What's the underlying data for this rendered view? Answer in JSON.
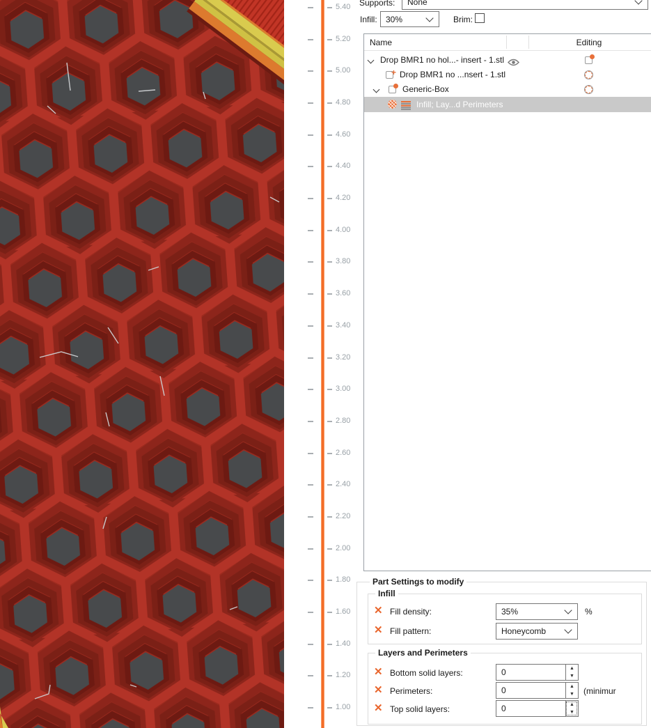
{
  "theme": {
    "accent_orange": "#f26a24",
    "icon_orange": "#e8703a",
    "wall_red": "#9c2a1e",
    "wall_red_light": "#b23327",
    "wall_red_mid": "#8d251b",
    "wall_red_dark": "#7b2016",
    "wall_red_deep": "#6d1a12",
    "hole_gray": "#484a4c",
    "band_yellow": "#d9cb4e",
    "band_yellow2": "#cfc144",
    "band_olive": "#a89a35",
    "band_orange": "#dd7a2e",
    "band_red": "#c23526",
    "band_rib": "#a32417",
    "band_shadow": "#6b1b12",
    "travel_gray": "#cdd0d2",
    "selected_row_bg": "#c9c9c9",
    "slider_label_gray": "#99a1a7"
  },
  "toolbar": {
    "supports_label": "Supports:",
    "supports_value": "None",
    "infill_label": "Infill:",
    "infill_value": "30%",
    "brim_label": "Brim:",
    "brim_checked": false
  },
  "layer_slider": {
    "tick_labels": [
      "5.40",
      "5.20",
      "5.00",
      "4.80",
      "4.60",
      "4.40",
      "4.20",
      "4.00",
      "3.80",
      "3.60",
      "3.40",
      "3.20",
      "3.00",
      "2.80",
      "2.60",
      "2.40",
      "2.20",
      "2.00",
      "1.80",
      "1.60",
      "1.40",
      "1.20",
      "1.00"
    ]
  },
  "object_tree": {
    "name_header": "Name",
    "editing_header": "Editing",
    "rows": [
      {
        "label": "Drop BMR1 no hol...- insert - 1.stl"
      },
      {
        "label": "Drop BMR1 no ...nsert - 1.stl"
      },
      {
        "label": "Generic-Box"
      },
      {
        "label": "Infill; Lay...d Perimeters"
      }
    ]
  },
  "part_settings": {
    "title": "Part Settings to modify",
    "infill_group": {
      "title": "Infill",
      "fill_density_label": "Fill density:",
      "fill_density_value": "35%",
      "fill_density_unit": "%",
      "fill_pattern_label": "Fill pattern:",
      "fill_pattern_value": "Honeycomb"
    },
    "layers_group": {
      "title": "Layers and Perimeters",
      "bottom_label": "Bottom solid layers:",
      "bottom_value": "0",
      "perimeters_label": "Perimeters:",
      "perimeters_value": "0",
      "perimeters_note": "(minimur",
      "top_label": "Top solid layers:",
      "top_value": "0"
    }
  }
}
